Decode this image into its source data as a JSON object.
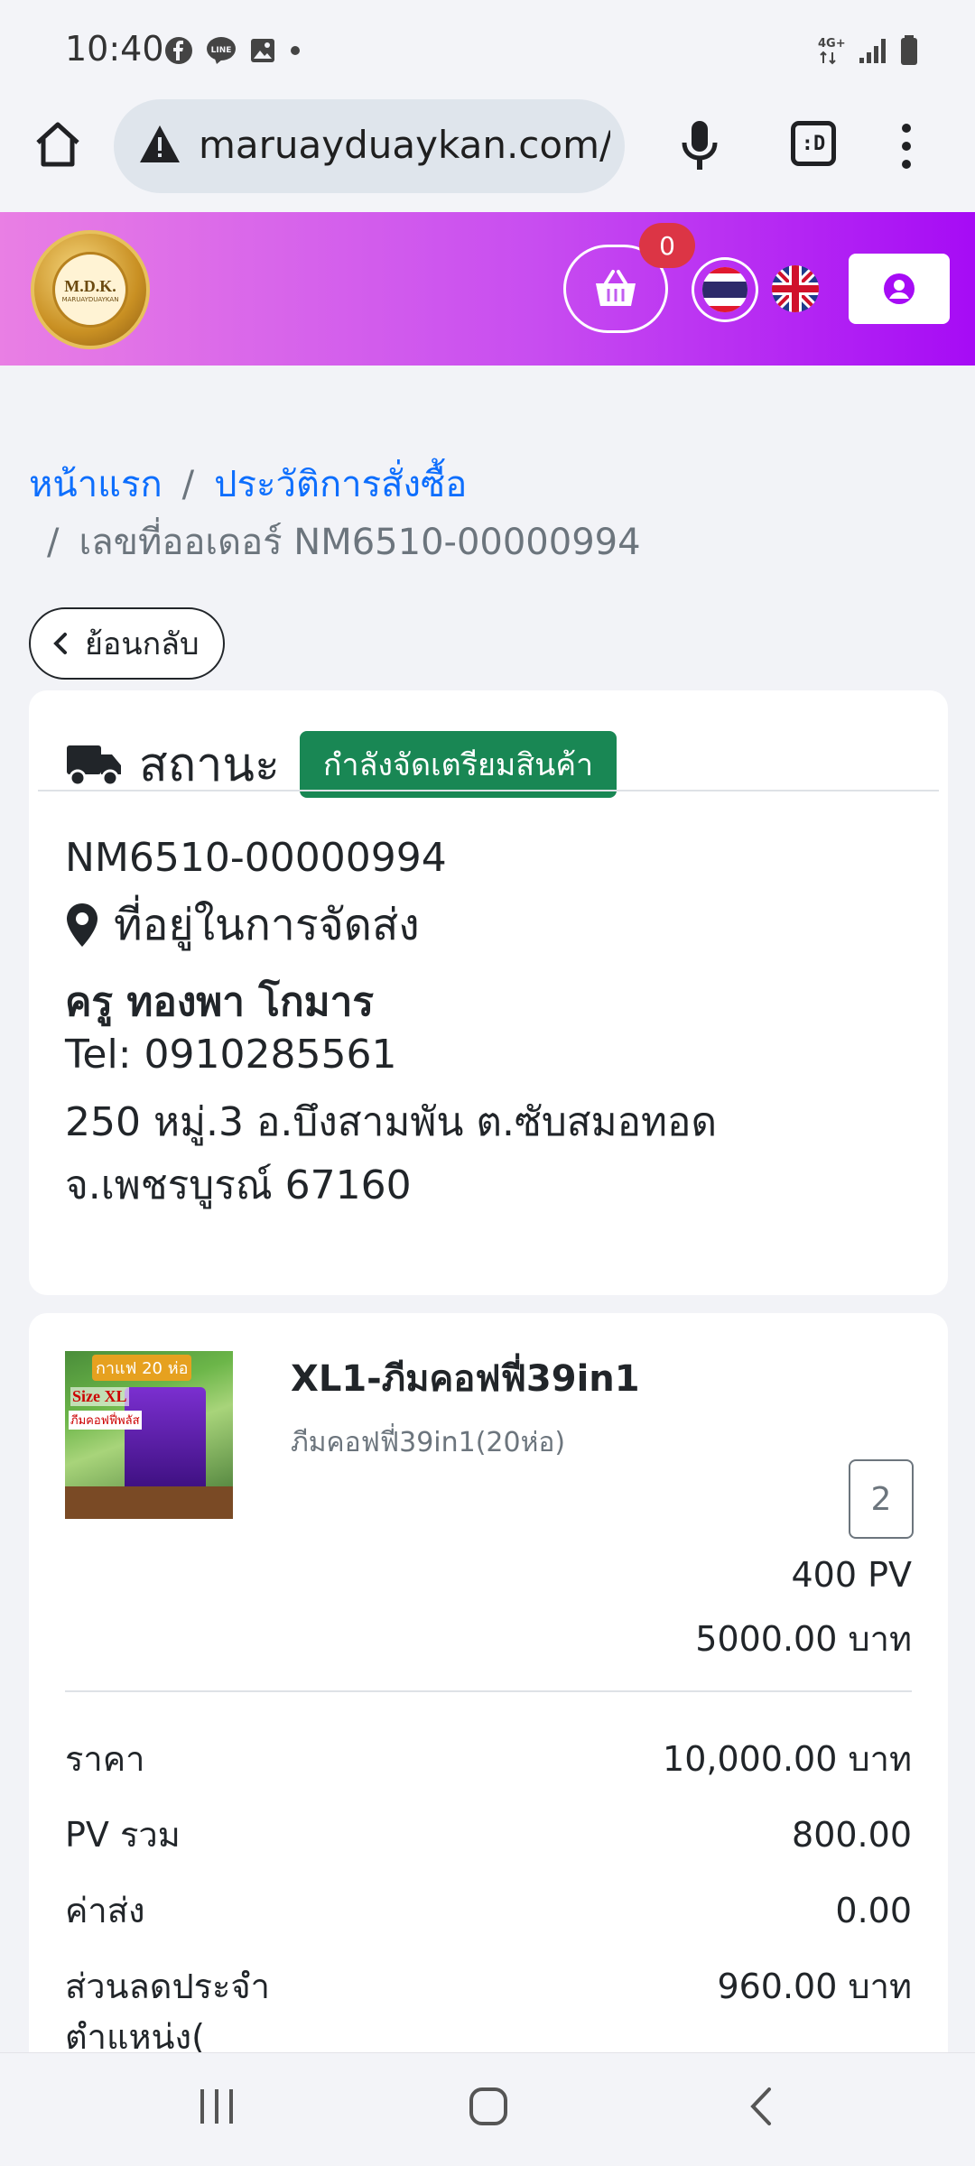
{
  "status_bar": {
    "time": "10:40",
    "network": "4G+"
  },
  "browser": {
    "url": "maruayduaykan.com/",
    "tabs_label": ":D"
  },
  "header": {
    "logo_text": "M.D.K.",
    "logo_subtext": "MARUAYDUAYKAN",
    "cart_count": "0"
  },
  "breadcrumb": {
    "home": "หน้าแรก",
    "history": "ประวัติการสั่งซื้อ",
    "current": "เลขที่ออเดอร์ NM6510-00000994"
  },
  "back_button": "ย้อนกลับ",
  "order": {
    "status_label": "สถานะ",
    "status_value": "กำลังจัดเตรียมสินค้า",
    "order_number": "NM6510-00000994",
    "address_title": "ที่อยู่ในการจัดส่ง",
    "customer_name": "ครู ทองพา โกมาร",
    "tel": "Tel: 0910285561",
    "address_line1": "250 หมู่.3 อ.บึงสามพัน ต.ซับสมอทอด",
    "address_line2": "จ.เพชรบูรณ์ 67160"
  },
  "product": {
    "image_label_top": "กาแฟ 20 ห่อ",
    "image_label_size": "Size XL",
    "image_label_sub": "ภีมคอฟฟี่พลัส",
    "name": "XL1-ภีมคอฟฟี่39in1",
    "description": "ภีมคอฟฟี่39in1(20ห่อ)",
    "quantity": "2",
    "pv": "400 PV",
    "price": "5000.00 บาท"
  },
  "summary": [
    {
      "label": "ราคา",
      "value": "10,000.00 บาท"
    },
    {
      "label": "PV รวม",
      "value": "800.00"
    },
    {
      "label": "ค่าส่ง",
      "value": "0.00"
    },
    {
      "label": "ส่วนลดประจำตำแหน่ง(",
      "value": "960.00 บาท"
    }
  ],
  "colors": {
    "header_gradient_start": "#e97fe4",
    "header_gradient_end": "#a60bf5",
    "link": "#0d6efd",
    "status_badge": "#198754",
    "cart_badge": "#dc3545"
  }
}
